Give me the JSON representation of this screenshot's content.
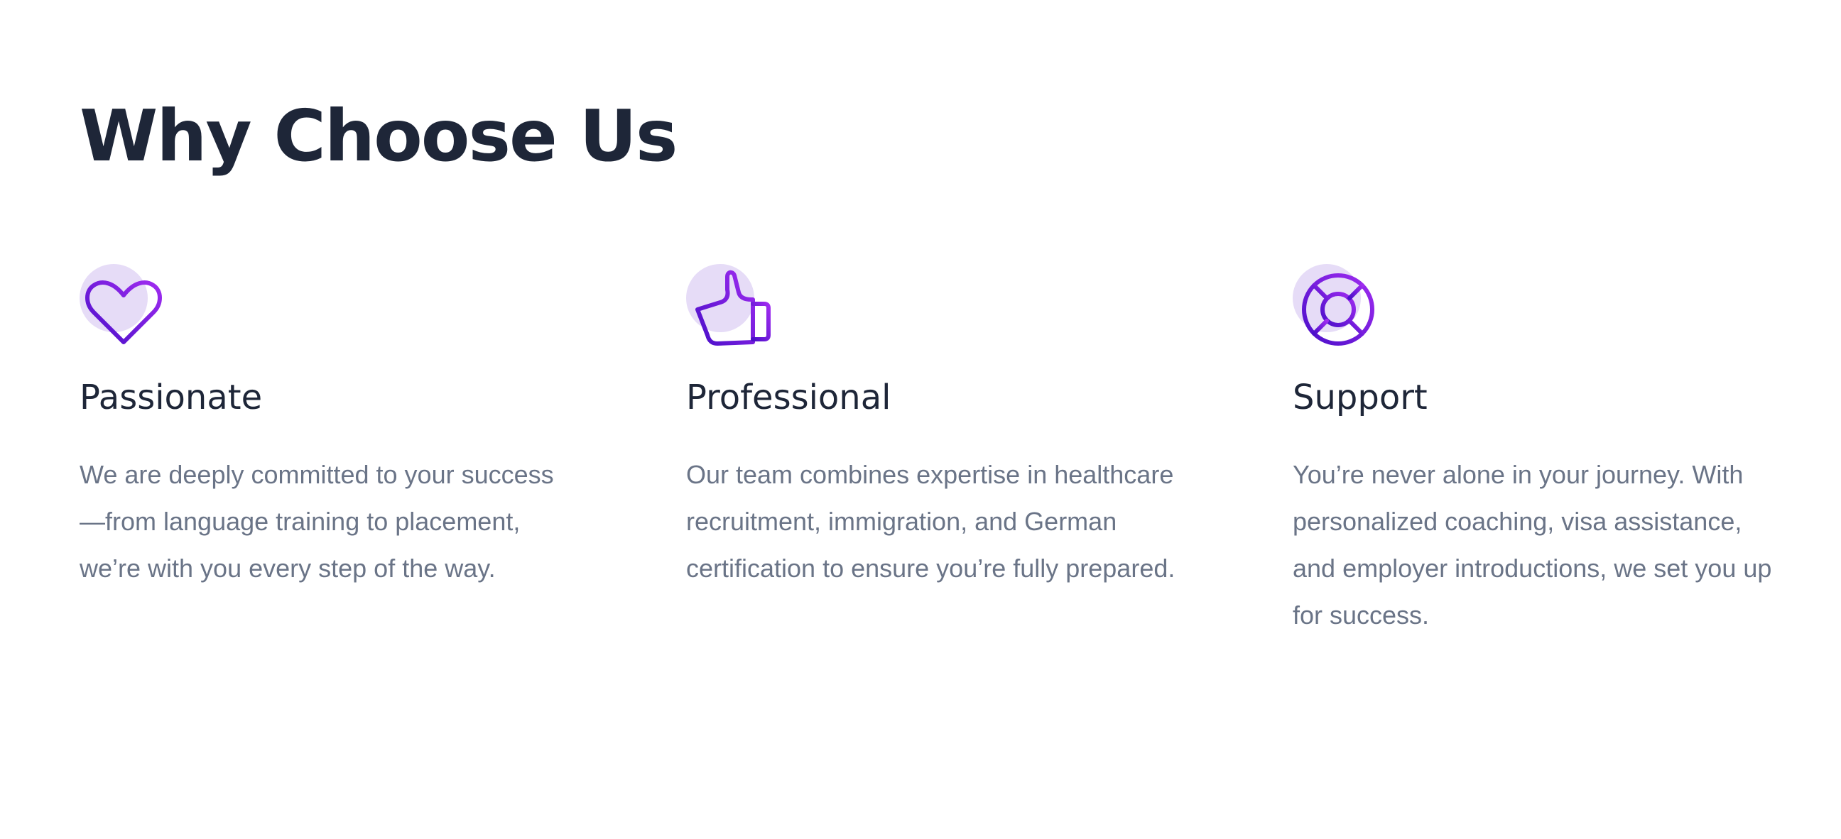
{
  "section": {
    "title": "Why Choose Us"
  },
  "colors": {
    "heading": "#1e2638",
    "body_text": "#6a7487",
    "icon_blob": "#e6dcf7",
    "icon_gradient_start": "#4a0fc9",
    "icon_gradient_end": "#a02cf0"
  },
  "features": [
    {
      "icon": "heart-icon",
      "title": "Passionate",
      "description": "We are deeply committed to your success—from language training to placement, we’re with you every step of the way."
    },
    {
      "icon": "thumbs-up-icon",
      "title": "Professional",
      "description": "Our team combines expertise in healthcare recruitment, immigration, and German certification to ensure you’re fully prepared."
    },
    {
      "icon": "lifebuoy-icon",
      "title": "Support",
      "description": "You’re never alone in your journey. With personalized coaching, visa assistance, and employer introductions, we set you up for success."
    }
  ]
}
